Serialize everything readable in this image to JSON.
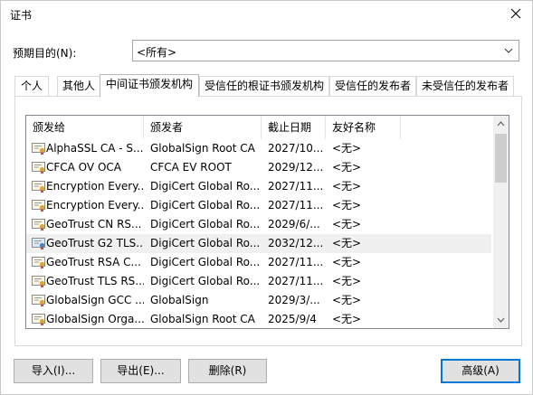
{
  "window": {
    "title": "证书"
  },
  "purpose": {
    "label": "预期目的(N):",
    "value": "<所有>"
  },
  "tabs": [
    {
      "label": "个人"
    },
    {
      "label": "其他人"
    },
    {
      "label": "中间证书颁发机构"
    },
    {
      "label": "受信任的根证书颁发机构"
    },
    {
      "label": "受信任的发布者"
    },
    {
      "label": "未受信任的发布者"
    }
  ],
  "active_tab": "中间证书颁发机构",
  "columns": [
    "颁发给",
    "颁发者",
    "截止日期",
    "友好名称"
  ],
  "rows": [
    [
      "AlphaSSL CA - S...",
      "GlobalSign Root CA",
      "2027/10...",
      "<无>"
    ],
    [
      "CFCA OV OCA",
      "CFCA EV ROOT",
      "2029/12...",
      "<无>"
    ],
    [
      "Encryption Every...",
      "DigiCert Global Ro...",
      "2027/11...",
      "<无>"
    ],
    [
      "Encryption Every...",
      "DigiCert Global Ro...",
      "2027/11...",
      "<无>"
    ],
    [
      "GeoTrust CN RS...",
      "DigiCert Global Ro...",
      "2029/6/...",
      "<无>"
    ],
    [
      "GeoTrust G2 TLS...",
      "DigiCert Global Ro...",
      "2032/12...",
      "<无>"
    ],
    [
      "GeoTrust RSA C...",
      "DigiCert Global Ro...",
      "2027/11...",
      "<无>"
    ],
    [
      "GeoTrust TLS RS...",
      "DigiCert Global Ro...",
      "2027/11...",
      "<无>"
    ],
    [
      "GlobalSign GCC ...",
      "GlobalSign",
      "2029/3/...",
      "<无>"
    ],
    [
      "GlobalSign Orga...",
      "GlobalSign Root CA",
      "2025/9/4",
      "<无>"
    ]
  ],
  "selected_row": 5,
  "buttons": {
    "import": "导入(I)...",
    "export": "导出(E)...",
    "remove": "删除(R)",
    "advanced": "高级(A)"
  },
  "colors": {
    "accent": "#0078d7",
    "selected_row_bg": "#f0f0f0"
  }
}
